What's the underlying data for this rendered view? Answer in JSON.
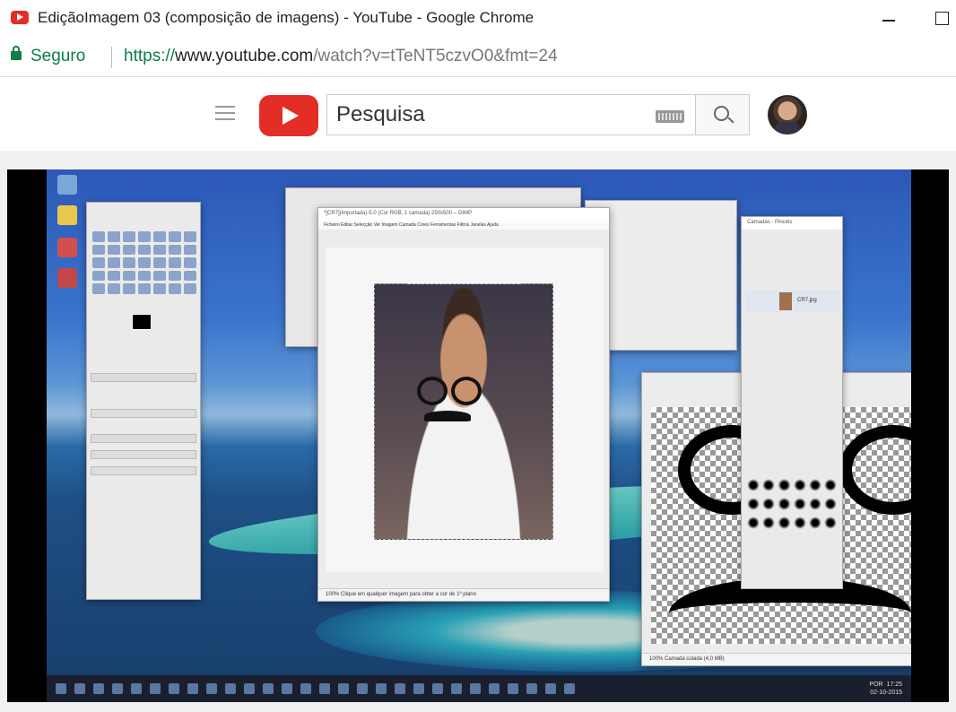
{
  "window": {
    "title": "EdiçãoImagem 03 (composição de imagens) - YouTube - Google Chrome"
  },
  "address": {
    "security_label": "Seguro",
    "url_scheme": "https://",
    "url_host": "www.youtube.com",
    "url_path": "/watch?v=tTeNT5czvO0&fmt=24"
  },
  "youtube": {
    "search_placeholder": "Pesquisa"
  },
  "video": {
    "gimp_main_title": "*[CR7](importada)-5.0 (Cor RGB, 1 camada) 250x500 – GIMP",
    "gimp_menu": "Ficheiro  Editar  Selecção  Ver  Imagem  Camada  Cores  Ferramentas  Filtros  Janelas  Ajuda",
    "gimp_status": "Clique em qualquer imagem para obter a cor de 1º plano",
    "transp_status": "Camada colada (4,0 MB)",
    "zoom": "100%",
    "layers_title": "Camadas - Pincéis",
    "layer_name": "CR7.jpg",
    "clock_time": "17:25",
    "clock_date": "02-10-2015",
    "lang": "POR"
  },
  "colors": {
    "youtube_red": "#e52d27",
    "secure_green": "#0b8043"
  }
}
